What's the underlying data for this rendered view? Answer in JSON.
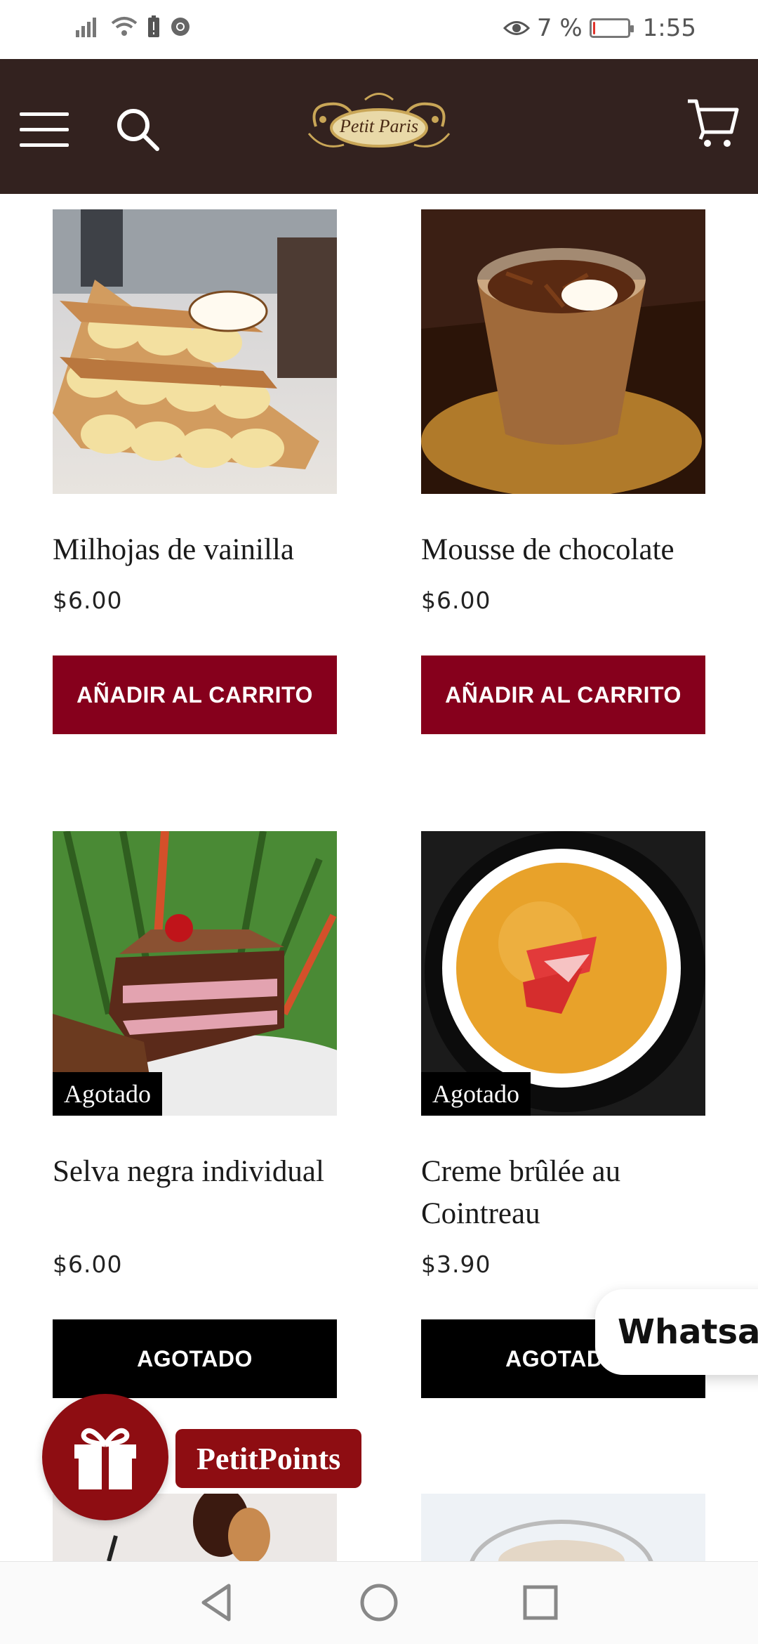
{
  "status_bar": {
    "battery": "7 %",
    "time": "1:55",
    "battery_level": 0.07
  },
  "header": {
    "logo_text": "Petit Paris"
  },
  "products": [
    {
      "title": "Milhojas de vainilla",
      "price": "$6.00",
      "button": "AÑADIR AL CARRITO",
      "badge": ""
    },
    {
      "title": "Mousse de chocolate",
      "price": "$6.00",
      "button": "AÑADIR AL CARRITO",
      "badge": ""
    },
    {
      "title": "Selva negra individual",
      "price": "$6.00",
      "button": "AGOTADO",
      "badge": "Agotado"
    },
    {
      "title": "Creme brûlée au Cointreau",
      "price": "$3.90",
      "button": "AGOTADO",
      "badge": "Agotado"
    }
  ],
  "floating": {
    "whatsapp_label": "Whatsapp",
    "points_label": "PetitPoints"
  },
  "colors": {
    "header_bg": "#33221f",
    "add_button": "#86001c",
    "sold_button": "#000000",
    "gift_bg": "#8e0d12"
  }
}
